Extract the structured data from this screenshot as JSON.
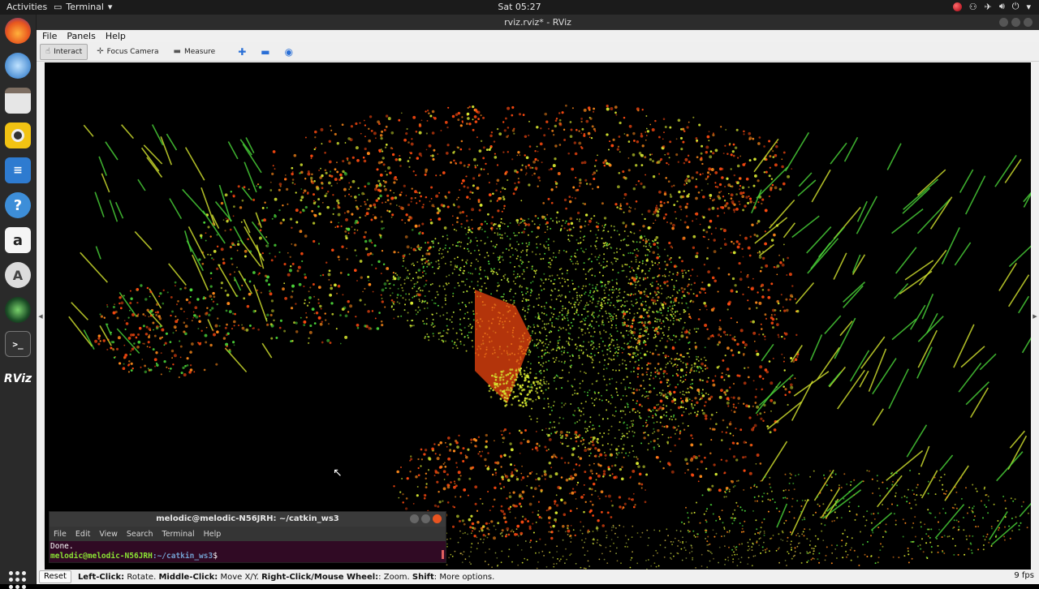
{
  "topbar": {
    "activities": "Activities",
    "app_menu": "Terminal",
    "clock": "Sat 05:27"
  },
  "dock": {
    "items": [
      "firefox",
      "thunderbird",
      "files",
      "rhythmbox",
      "libreoffice-writer",
      "help",
      "amazon",
      "software-updater",
      "rviz-camera",
      "terminal",
      "rviz"
    ],
    "rviz_label": "RViz"
  },
  "window": {
    "title": "rviz.rviz* - RViz",
    "menu": [
      "File",
      "Panels",
      "Help"
    ],
    "toolbar": {
      "interact": "Interact",
      "focus_camera": "Focus Camera",
      "measure": "Measure"
    },
    "status": {
      "reset": "Reset",
      "hint_parts": [
        {
          "b": "Left-Click:",
          "t": " Rotate. "
        },
        {
          "b": "Middle-Click:",
          "t": " Move X/Y. "
        },
        {
          "b": "Right-Click/Mouse Wheel:",
          "t": ": Zoom. "
        },
        {
          "b": "Shift",
          "t": ": More options."
        }
      ],
      "fps": "9 fps"
    }
  },
  "terminal": {
    "title": "melodic@melodic-N56JRH: ~/catkin_ws3",
    "menu": [
      "File",
      "Edit",
      "View",
      "Search",
      "Terminal",
      "Help"
    ],
    "line1": "Done.",
    "prompt_user": "melodic@melodic-N56JRH",
    "prompt_path": ":~/catkin_ws3",
    "prompt_end": "$"
  },
  "colors": {
    "point_red": "#ff4a10",
    "point_orange": "#ff8a1a",
    "point_yellow": "#d8e830",
    "point_green": "#4cd83a",
    "terminal_bg": "#300a24",
    "ubuntu_orange": "#e95420"
  }
}
